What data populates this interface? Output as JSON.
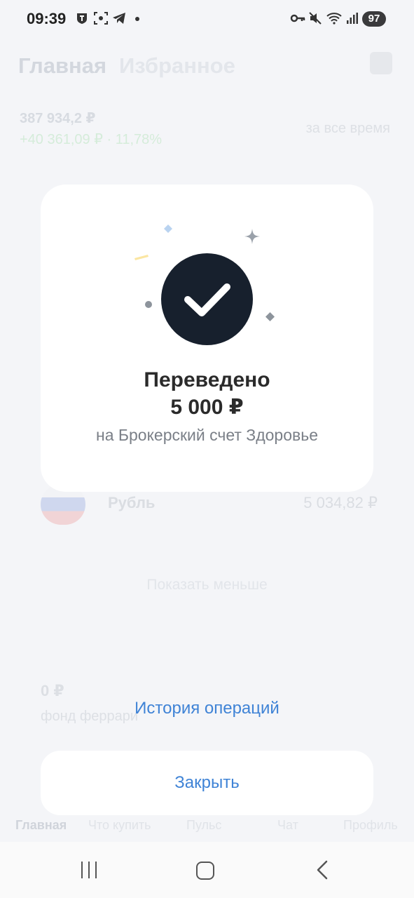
{
  "status_bar": {
    "time": "09:39",
    "battery": "97",
    "left_icons": [
      "tinkoff-notification-icon",
      "screenshot-icon",
      "telegram-icon",
      "dot-icon"
    ],
    "right_icons": [
      "vpn-key-icon",
      "mute-icon",
      "wifi-icon",
      "signal-icon"
    ]
  },
  "background": {
    "tabs": [
      "Главная",
      "Избранное"
    ],
    "portfolio_total": "387 934,2  ₽",
    "portfolio_change": "+40 361,09 ₽ · 11,78%",
    "period": "за все время",
    "currency_name": "Рубль",
    "currency_value": "5 034,82 ₽",
    "show_less": "Показать меньше",
    "fund_value": "0 ₽",
    "fund_name": "фонд феррари",
    "nav_items": [
      "Главная",
      "Что купить",
      "Пульс",
      "Чат",
      "Профиль"
    ]
  },
  "dialog": {
    "title": "Переведено",
    "amount": "5 000 ₽",
    "subtitle": "на Брокерский счет Здоровье"
  },
  "actions": {
    "history_link": "История операций",
    "close_button": "Закрыть"
  },
  "colors": {
    "accent": "#3f83d6",
    "check_circle": "#17202d",
    "background": "#f4f5f8"
  }
}
